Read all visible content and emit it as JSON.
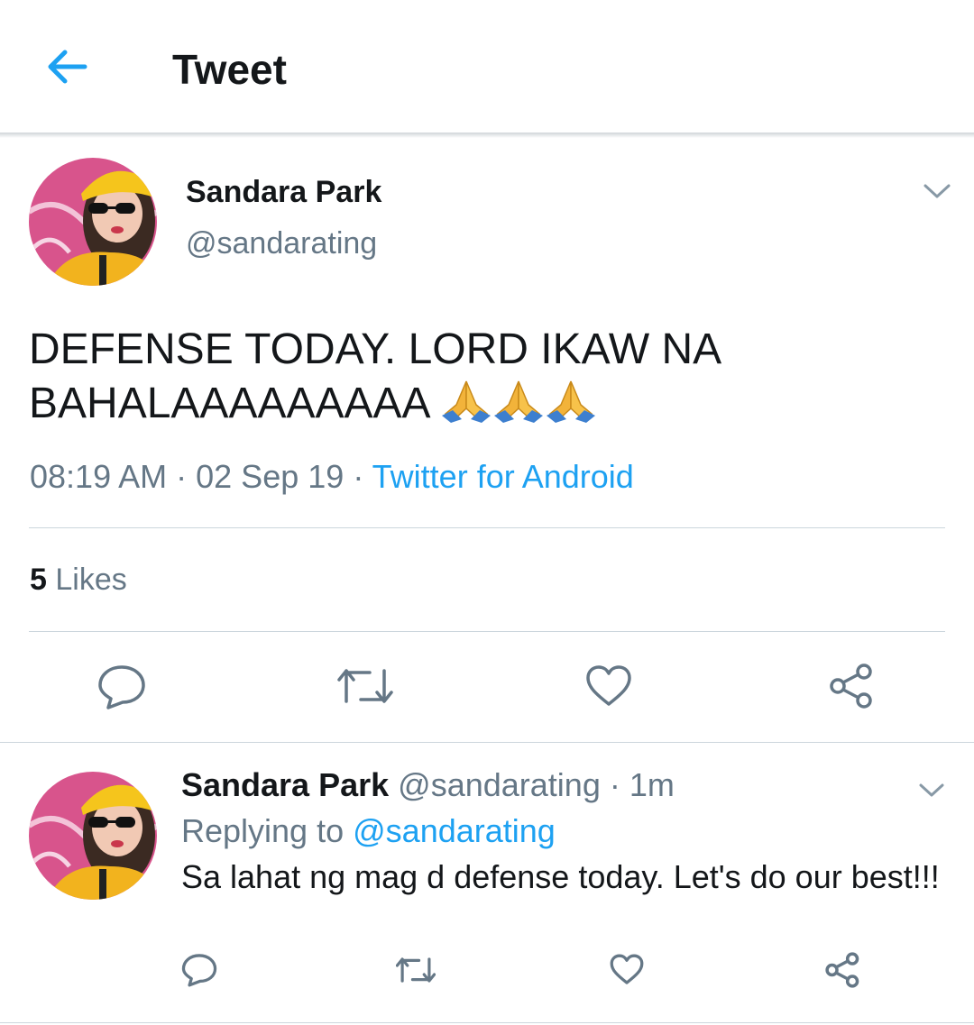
{
  "header": {
    "title": "Tweet",
    "back_icon": "arrow-left-icon"
  },
  "tweet": {
    "author_name": "Sandara Park",
    "author_handle": "@sandarating",
    "text_line1": "DEFENSE TODAY. LORD IKAW NA",
    "text_line2": "BAHALAAAAAAAAA",
    "emoji": "folded-hands-emoji",
    "emoji_count": 3,
    "time": "08:19 AM",
    "date": "02 Sep 19",
    "separator": "·",
    "source": "Twitter for Android",
    "likes_count": "5",
    "likes_label": "Likes"
  },
  "reply": {
    "author_name": "Sandara Park",
    "author_handle": "@sandarating",
    "age": "1m",
    "replying_prefix": "Replying to",
    "replying_to": "@sandarating",
    "text": "Sa lahat ng mag d defense today. Let's do our best!!!"
  },
  "colors": {
    "accent": "#1da1f2",
    "text_primary": "#14171a",
    "text_secondary": "#657786",
    "divider": "#ccd6dd",
    "icon": "#657786"
  }
}
